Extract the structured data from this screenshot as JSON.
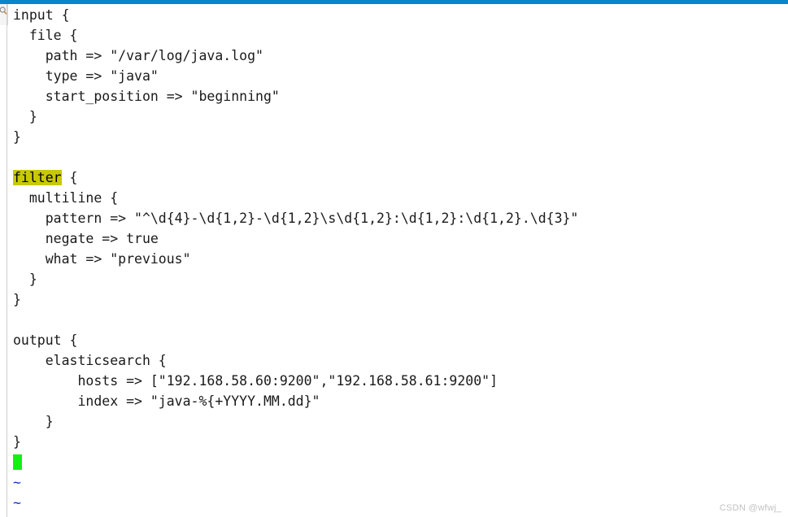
{
  "window": {
    "accent_color": "#0a84cc",
    "background_color": "#ffffff",
    "app_icon": "magnifier-icon"
  },
  "editor": {
    "highlight_color": "#c9c900",
    "cursor_color": "#14f014",
    "tilde_color": "#1430d0",
    "text_color": "#1a1a1a",
    "lines": [
      {
        "text": "input {"
      },
      {
        "text": "  file {"
      },
      {
        "text": "    path => \"/var/log/java.log\""
      },
      {
        "text": "    type => \"java\""
      },
      {
        "text": "    start_position => \"beginning\""
      },
      {
        "text": "  }"
      },
      {
        "text": "}"
      },
      {
        "text": ""
      },
      {
        "text": "filter {",
        "highlight": "filter",
        "rest": " {"
      },
      {
        "text": "  multiline {"
      },
      {
        "text": "    pattern => \"^\\d{4}-\\d{1,2}-\\d{1,2}\\s\\d{1,2}:\\d{1,2}:\\d{1,2}.\\d{3}\""
      },
      {
        "text": "    negate => true"
      },
      {
        "text": "    what => \"previous\""
      },
      {
        "text": "  }"
      },
      {
        "text": "}"
      },
      {
        "text": ""
      },
      {
        "text": "output {"
      },
      {
        "text": "    elasticsearch {"
      },
      {
        "text": "        hosts => [\"192.168.58.60:9200\",\"192.168.58.61:9200\"]"
      },
      {
        "text": "        index => \"java-%{+YYYY.MM.dd}\""
      },
      {
        "text": "    }"
      },
      {
        "text": "}"
      }
    ],
    "cursor_row_label": "",
    "empty_markers": [
      "~",
      "~"
    ]
  },
  "line_refs": {
    "l0": "input {",
    "l1": "  file {",
    "l2": "    path => \"/var/log/java.log\"",
    "l3": "    type => \"java\"",
    "l4": "    start_position => \"beginning\"",
    "l5": "  }",
    "l6": "}",
    "l7": "",
    "l8_highlight": "filter",
    "l8_rest": " {",
    "l9": "  multiline {",
    "l10": "    pattern => \"^\\d{4}-\\d{1,2}-\\d{1,2}\\s\\d{1,2}:\\d{1,2}:\\d{1,2}.\\d{3}\"",
    "l11": "    negate => true",
    "l12": "    what => \"previous\"",
    "l13": "  }",
    "l14": "}",
    "l15": "",
    "l16": "output {",
    "l17": "    elasticsearch {",
    "l18": "        hosts => [\"192.168.58.60:9200\",\"192.168.58.61:9200\"]",
    "l19": "        index => \"java-%{+YYYY.MM.dd}\"",
    "l20": "    }",
    "l21": "}",
    "tilde1": "~",
    "tilde2": "~"
  },
  "watermark": {
    "text": "CSDN @wfwj_"
  }
}
